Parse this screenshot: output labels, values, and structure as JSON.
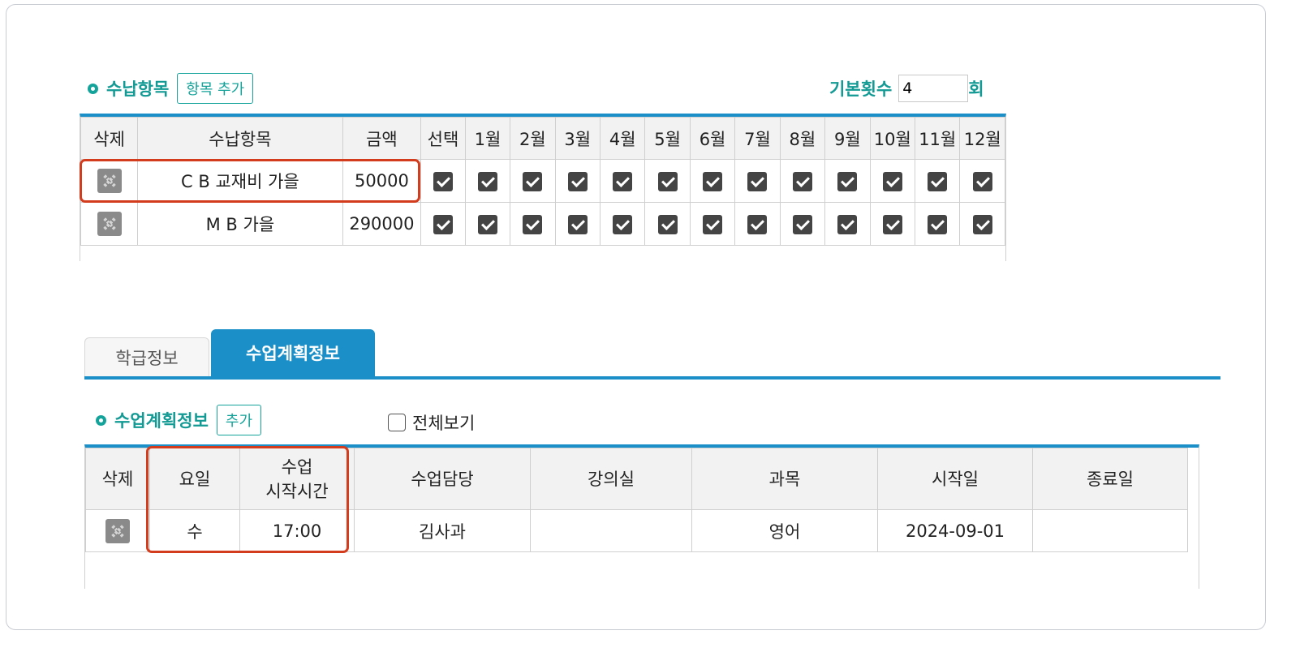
{
  "payment": {
    "title": "수납항목",
    "add_button": "항목 추가",
    "base_count_label": "기본횟수",
    "base_count_value": "4",
    "base_count_unit": "회",
    "headers": [
      "삭제",
      "수납항목",
      "금액",
      "선택",
      "1월",
      "2월",
      "3월",
      "4월",
      "5월",
      "6월",
      "7월",
      "8월",
      "9월",
      "10월",
      "11월",
      "12월"
    ],
    "rows": [
      {
        "name": "C B 교재비 가을",
        "amount": "50000",
        "checks": [
          true,
          true,
          true,
          true,
          true,
          true,
          true,
          true,
          true,
          true,
          true,
          true,
          true
        ]
      },
      {
        "name": "M B 가을",
        "amount": "290000",
        "checks": [
          true,
          true,
          true,
          true,
          true,
          true,
          true,
          true,
          true,
          true,
          true,
          true,
          true
        ]
      }
    ]
  },
  "tabs": [
    {
      "label": "학급정보",
      "active": false
    },
    {
      "label": "수업계획정보",
      "active": true
    }
  ],
  "plan": {
    "title": "수업계획정보",
    "add_button": "추가",
    "view_all_label": "전체보기",
    "view_all_checked": false,
    "headers": [
      "삭제",
      "요일",
      "수업\n시작시간",
      "수업담당",
      "강의실",
      "과목",
      "시작일",
      "종료일"
    ],
    "rows": [
      {
        "day": "수",
        "start_time": "17:00",
        "teacher": "김사과",
        "room": "",
        "subject": "영어",
        "start_date": "2024-09-01",
        "end_date": ""
      }
    ]
  },
  "colors": {
    "accent": "#14a39a",
    "tab_blue": "#1b8fc8",
    "highlight": "#d33c1d"
  }
}
